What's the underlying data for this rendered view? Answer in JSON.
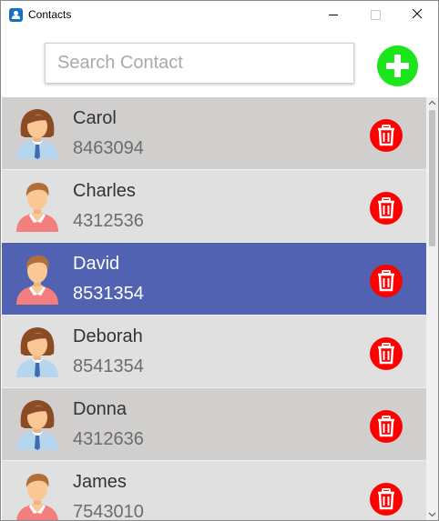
{
  "window": {
    "title": "Contacts"
  },
  "search": {
    "placeholder": "Search Contact",
    "value": ""
  },
  "colors": {
    "accent_add": "#1ce51c",
    "delete": "#ff0000",
    "selected_row": "#5062b1",
    "row_female": "#d1cfce",
    "row_male": "#e0e0e0"
  },
  "contacts": [
    {
      "name": "Carol",
      "phone": "8463094",
      "avatar": "female-avatar-icon",
      "selected": false
    },
    {
      "name": "Charles",
      "phone": "4312536",
      "avatar": "male-avatar-icon",
      "selected": false
    },
    {
      "name": "David",
      "phone": "8531354",
      "avatar": "male-avatar-icon",
      "selected": true
    },
    {
      "name": "Deborah",
      "phone": "8541354",
      "avatar": "female-avatar-icon",
      "selected": false
    },
    {
      "name": "Donna",
      "phone": "4312636",
      "avatar": "female-avatar-icon",
      "selected": false
    },
    {
      "name": "James",
      "phone": "7543010",
      "avatar": "male-avatar-icon",
      "selected": false
    }
  ],
  "icons": {
    "add": "plus-icon",
    "delete": "trash-icon",
    "window": "contact-book-icon"
  }
}
